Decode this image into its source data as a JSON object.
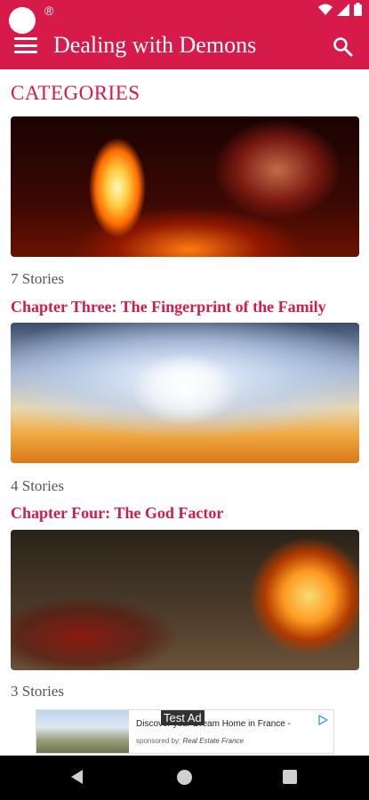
{
  "app": {
    "title": "Dealing with Demons"
  },
  "section": {
    "heading": "CATEGORIES"
  },
  "categories": [
    {
      "count": "7 Stories",
      "next_chapter": "Chapter Three: The Fingerprint of the Family"
    },
    {
      "count": "4 Stories",
      "next_chapter": "Chapter Four: The God Factor"
    },
    {
      "count": "3 Stories"
    }
  ],
  "ad": {
    "badge": "Test Ad",
    "title": "Discover your Dream Home in France -",
    "sponsored_prefix": "sponsored by:",
    "sponsor": "Real Estate France"
  },
  "icons": {
    "menu": "hamburger-icon",
    "search": "search-icon",
    "wifi": "wifi-icon",
    "signal": "signal-icon",
    "battery": "battery-icon",
    "ad_info": "ad-choices-icon",
    "nav_back": "back-icon",
    "nav_home": "home-icon",
    "nav_recent": "recents-icon"
  },
  "colors": {
    "accent": "#d61a4a",
    "nav_bar": "#000000"
  }
}
